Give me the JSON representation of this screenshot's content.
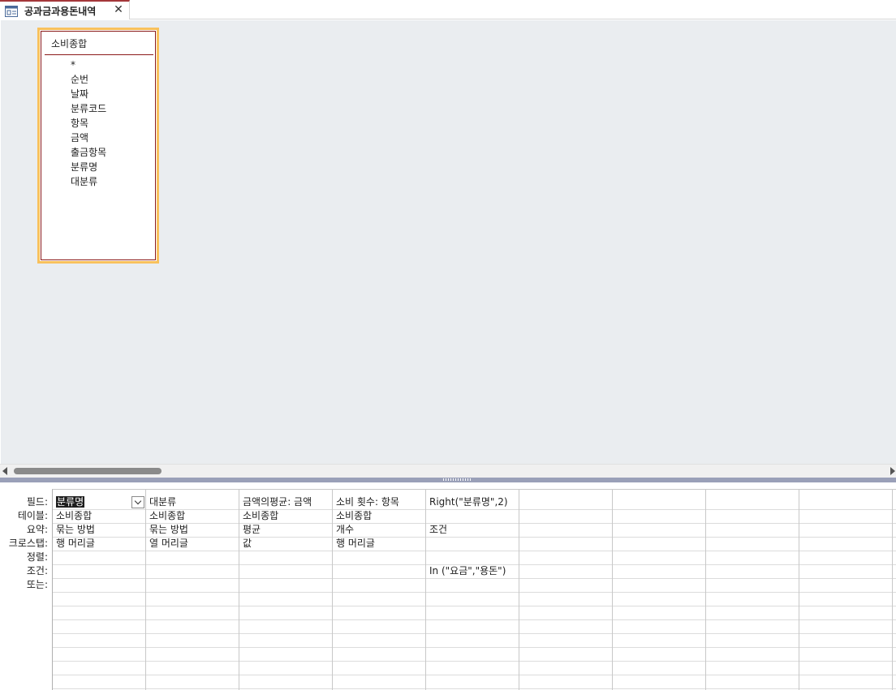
{
  "tab": {
    "title": "공과금과용돈내역",
    "close_glyph": "✕"
  },
  "field_list": {
    "title": "소비종합",
    "fields": [
      "*",
      "순번",
      "날짜",
      "분류코드",
      "항목",
      "금액",
      "출금항목",
      "분류명",
      "대분류"
    ]
  },
  "grid": {
    "row_labels": [
      "필드:",
      "테이블:",
      "요약:",
      "크로스탭:",
      "정렬:",
      "조건:",
      "또는:"
    ],
    "columns": [
      {
        "field": "분류명",
        "table": "소비종합",
        "total": "묶는 방법",
        "crosstab": "행 머리글",
        "sort": "",
        "criteria": "",
        "or": ""
      },
      {
        "field": "대분류",
        "table": "소비종합",
        "total": "묶는 방법",
        "crosstab": "열 머리글",
        "sort": "",
        "criteria": "",
        "or": ""
      },
      {
        "field": "금액의평균: 금액",
        "table": "소비종합",
        "total": "평균",
        "crosstab": "값",
        "sort": "",
        "criteria": "",
        "or": ""
      },
      {
        "field": "소비 횟수: 항목",
        "table": "소비종합",
        "total": "개수",
        "crosstab": "행 머리글",
        "sort": "",
        "criteria": "",
        "or": ""
      },
      {
        "field": "Right(\"분류명\",2)",
        "table": "",
        "total": "조건",
        "crosstab": "",
        "sort": "",
        "criteria": "In (\"요금\",\"용돈\")",
        "or": ""
      },
      {
        "field": "",
        "table": "",
        "total": "",
        "crosstab": "",
        "sort": "",
        "criteria": "",
        "or": ""
      },
      {
        "field": "",
        "table": "",
        "total": "",
        "crosstab": "",
        "sort": "",
        "criteria": "",
        "or": ""
      },
      {
        "field": "",
        "table": "",
        "total": "",
        "crosstab": "",
        "sort": "",
        "criteria": "",
        "or": ""
      },
      {
        "field": "",
        "table": "",
        "total": "",
        "crosstab": "",
        "sort": "",
        "criteria": "",
        "or": ""
      }
    ]
  },
  "colors": {
    "tab_accent": "#a4373a",
    "field_list_highlight": "#f8c15c",
    "field_list_border": "#8b1a1a",
    "pane_background": "#eaedf0",
    "splitter": "#9aa0b8"
  }
}
